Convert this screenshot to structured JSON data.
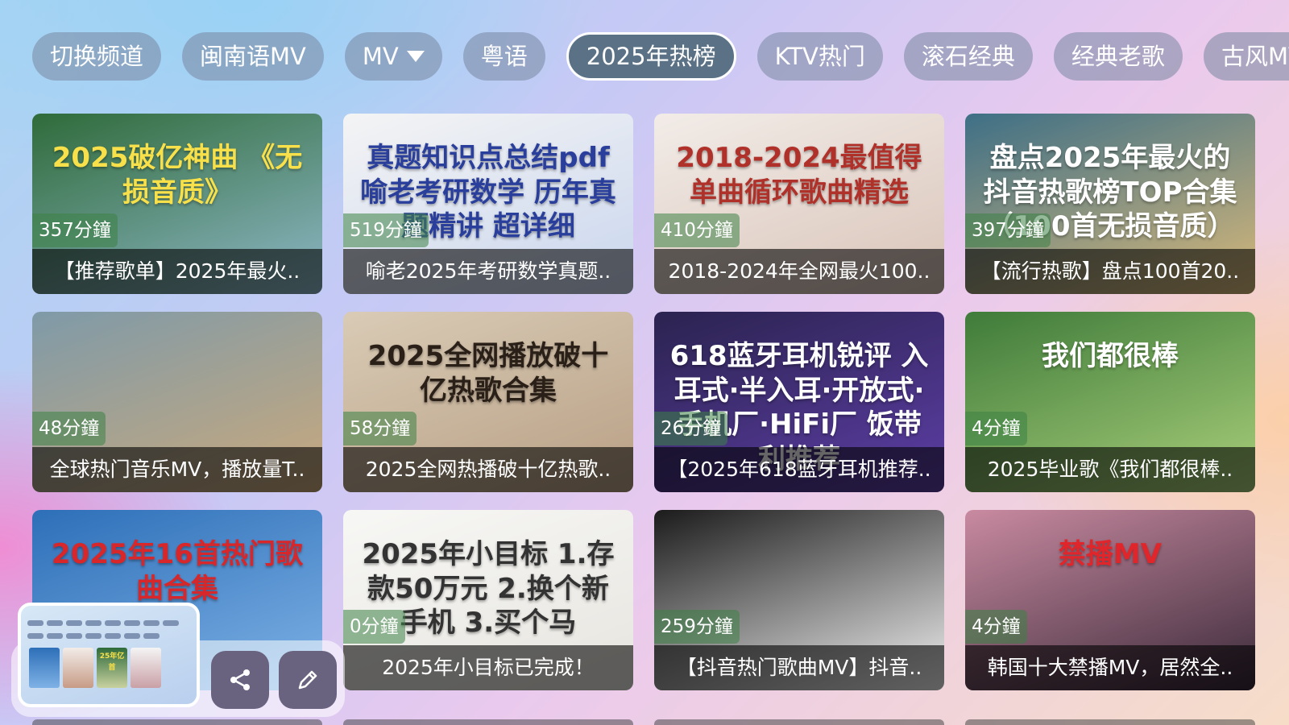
{
  "tabs": [
    {
      "label": "切换频道",
      "active": false
    },
    {
      "label": "闽南语MV",
      "active": false
    },
    {
      "label": "MV",
      "active": false,
      "icon": "filter-icon"
    },
    {
      "label": "粤语",
      "active": false
    },
    {
      "label": "2025年热榜",
      "active": true
    },
    {
      "label": "KTV热门",
      "active": false
    },
    {
      "label": "滚石经典",
      "active": false
    },
    {
      "label": "经典老歌",
      "active": false
    },
    {
      "label": "古风MV",
      "active": false
    }
  ],
  "videos": [
    {
      "thumb_text": "2025破亿神曲 《无损音质》",
      "duration": "357分鐘",
      "title": "【推荐歌单】2025年最火..",
      "thumb_colors": [
        "#2f6b3a",
        "#8fb8c8"
      ],
      "text_color": "#f7e04a"
    },
    {
      "thumb_text": "真题知识点总结pdf 喻老考研数学 历年真题精讲 超详细",
      "duration": "519分鐘",
      "title": "喻老2025年考研数学真题..",
      "thumb_colors": [
        "#f4f4f4",
        "#c9d6ee"
      ],
      "text_color": "#2a3f9b"
    },
    {
      "thumb_text": "2018-2024最值得单曲循环歌曲精选",
      "duration": "410分鐘",
      "title": "2018-2024年全网最火100..",
      "thumb_colors": [
        "#f2ece8",
        "#d9c4b8"
      ],
      "text_color": "#b0302a"
    },
    {
      "thumb_text": "盘点2025年最火的 抖音热歌榜TOP合集 （100首无损音质）",
      "duration": "397分鐘",
      "title": "【流行热歌】盘点100首20..",
      "thumb_colors": [
        "#3e6f86",
        "#d9b97a"
      ],
      "text_color": "#ffffff"
    },
    {
      "thumb_text": "",
      "duration": "48分鐘",
      "title": "全球热门音乐MV，播放量T..",
      "thumb_colors": [
        "#7f9aa8",
        "#c9a97d"
      ],
      "text_color": "#ffffff"
    },
    {
      "thumb_text": "2025全网播放破十亿热歌合集",
      "duration": "58分鐘",
      "title": "2025全网热播破十亿热歌..",
      "thumb_colors": [
        "#d9cbb6",
        "#b89f84"
      ],
      "text_color": "#2a2018"
    },
    {
      "thumb_text": "618蓝牙耳机锐评 入耳式·半入耳·开放式·手机厂·HiFi厂 饭带利推荐",
      "duration": "26分鐘",
      "title": "【2025年618蓝牙耳机推荐..",
      "thumb_colors": [
        "#2b2350",
        "#5d3ea6"
      ],
      "text_color": "#ffffff"
    },
    {
      "thumb_text": "我们都很棒",
      "duration": "4分鐘",
      "title": "2025毕业歌《我们都很棒..",
      "thumb_colors": [
        "#3f7b3a",
        "#a9cf7a"
      ],
      "text_color": "#ffffff"
    },
    {
      "thumb_text": "2025年16首热门歌曲合集",
      "duration": "",
      "title": "",
      "thumb_colors": [
        "#2d6fb8",
        "#7fb2e6"
      ],
      "text_color": "#d8272a"
    },
    {
      "thumb_text": "2025年小目标 1.存款50万元 2.换个新手机 3.买个马",
      "duration": "0分鐘",
      "title": "2025年小目标已完成！",
      "thumb_colors": [
        "#f7f7f5",
        "#e7e5df"
      ],
      "text_color": "#333333"
    },
    {
      "thumb_text": "",
      "duration": "259分鐘",
      "title": "【抖音热门歌曲MV】抖音..",
      "thumb_colors": [
        "#1b1b1b",
        "#f2f2f2"
      ],
      "text_color": "#ffffff"
    },
    {
      "thumb_text": "禁播MV",
      "duration": "4分鐘",
      "title": "韩国十大禁播MV，居然全..",
      "thumb_colors": [
        "#c98aa0",
        "#3a2a3a"
      ],
      "text_color": "#e0262b"
    }
  ],
  "dock": {
    "share_icon": "share-icon",
    "edit_icon": "pencil-icon"
  },
  "preview_thumb_text": "25年亿首"
}
